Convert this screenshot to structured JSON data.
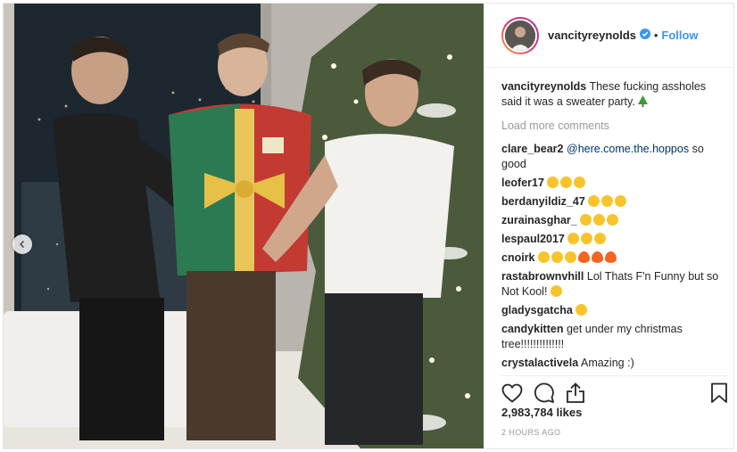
{
  "post": {
    "username": "vancityreynolds",
    "follow_label": "Follow",
    "separator": "•",
    "caption_user": "vancityreynolds",
    "caption_text": "These fucking assholes said it was a sweater party.",
    "caption_icon": "christmas-tree-emoji",
    "load_more": "Load more comments",
    "likes": "2,983,784 likes",
    "timestamp": "2 HOURS AGO"
  },
  "comments": [
    {
      "user": "clare_bear2",
      "mention": "@here.come.the.hoppos",
      "text": "so good",
      "emoji": []
    },
    {
      "user": "leofer17",
      "text": "",
      "emoji": [
        "laugh",
        "laugh",
        "laugh"
      ]
    },
    {
      "user": "berdanyildiz_47",
      "text": "",
      "emoji": [
        "laugh",
        "laugh",
        "laugh"
      ]
    },
    {
      "user": "zurainasghar_",
      "text": "",
      "emoji": [
        "laugh",
        "laugh",
        "laugh"
      ]
    },
    {
      "user": "lespaul2017",
      "text": "",
      "emoji": [
        "laugh",
        "laugh",
        "laugh"
      ]
    },
    {
      "user": "cnoirk",
      "text": "",
      "emoji": [
        "rofl",
        "rofl",
        "rofl",
        "fire",
        "fire",
        "fire"
      ]
    },
    {
      "user": "rastabrownvhill",
      "text": "Lol Thats F'n Funny but so Not Kool!",
      "emoji": [
        "smile"
      ]
    },
    {
      "user": "gladysgatcha",
      "text": "",
      "emoji": [
        "rofl"
      ]
    },
    {
      "user": "candykitten",
      "text": "get under my christmas tree!!!!!!!!!!!!!!",
      "emoji": []
    },
    {
      "user": "crystalactivela",
      "text": "Amazing :)",
      "emoji": []
    }
  ],
  "icons": {
    "like": "heart-icon",
    "comment": "comment-icon",
    "share": "share-icon",
    "save": "bookmark-icon",
    "verified": "verified-badge-icon",
    "prev": "chevron-left-icon"
  },
  "colors": {
    "link": "#3897f0",
    "mention": "#003569",
    "muted": "#999999",
    "emoji_laugh": "#f7c52b",
    "emoji_fire": "#f26522"
  }
}
